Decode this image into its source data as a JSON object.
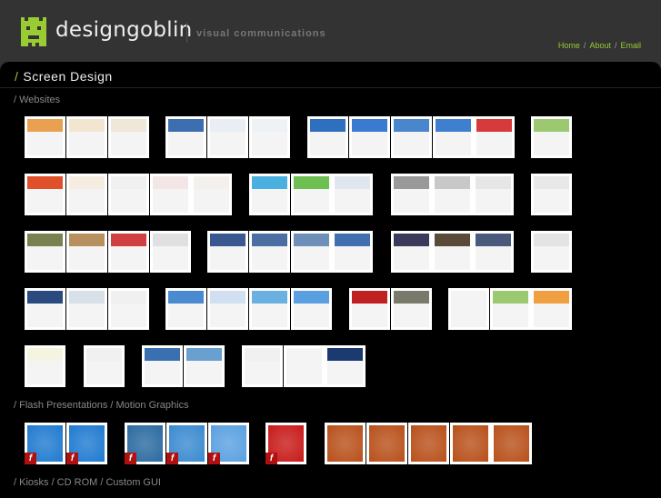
{
  "header": {
    "brand": "designgoblin",
    "tagline": "visual communications",
    "nav": [
      "Home",
      "About",
      "Email"
    ],
    "nav_sep": "/"
  },
  "page": {
    "title_slash": "/",
    "title": "Screen Design"
  },
  "sections": [
    {
      "label": "/ Websites"
    },
    {
      "label": "/ Flash Presentations / Motion Graphics"
    },
    {
      "label": "/ Kiosks / CD ROM / Custom GUI"
    }
  ],
  "colors": {
    "accent": "#99cc33",
    "flash_badge": "#b01010"
  },
  "website_thumb_colors": [
    "#e9a050",
    "#f3e6d0",
    "#efe8d8",
    "#3d6fb0",
    "#e8eef4",
    "#eef2f4",
    "#2f6fc0",
    "#3a7ad0",
    "#4a86cc",
    "#3e7fd0",
    "#d63a3a",
    "#9cc870",
    "#e0502a",
    "#f5eee0",
    "#f0f0f0",
    "#f2e6e6",
    "#f4f0ec",
    "#4ab0e0",
    "#6cbf50",
    "#e0e6ee",
    "#999999",
    "#c8c8c8",
    "#e6e6e6",
    "#e8e8e8",
    "#7a8050",
    "#b89060",
    "#d04040",
    "#e0e0e0",
    "#3a5890",
    "#4a6fa0",
    "#6e8fb8",
    "#4070b0",
    "#3a3a5a",
    "#5a4a3a",
    "#4a5a7a",
    "#e4e4e4",
    "#2a4a80",
    "#d8e0e8",
    "#f0f0f0",
    "#4a8ad0",
    "#d0e0f0",
    "#6ab0e0",
    "#5aa0e0",
    "#c02020",
    "#7a7a6a",
    "#f4f4f4",
    "#9cc870",
    "#f0a040",
    "#f4f4e0",
    "#f0f0f0",
    "#3a70b0",
    "#6aa0d0",
    "#f0f0f0",
    "#f4f4f4",
    "#1a3a70"
  ],
  "flash_thumb_colors": [
    "#1f7ad0",
    "#1f7ad0",
    "#2a6aa0",
    "#3a8ad0",
    "#5aa0e0",
    "#c81a1a",
    "#b8501a",
    "#b8501a",
    "#b8501a",
    "#b8501a",
    "#b8501a"
  ],
  "flash_icon": "f"
}
